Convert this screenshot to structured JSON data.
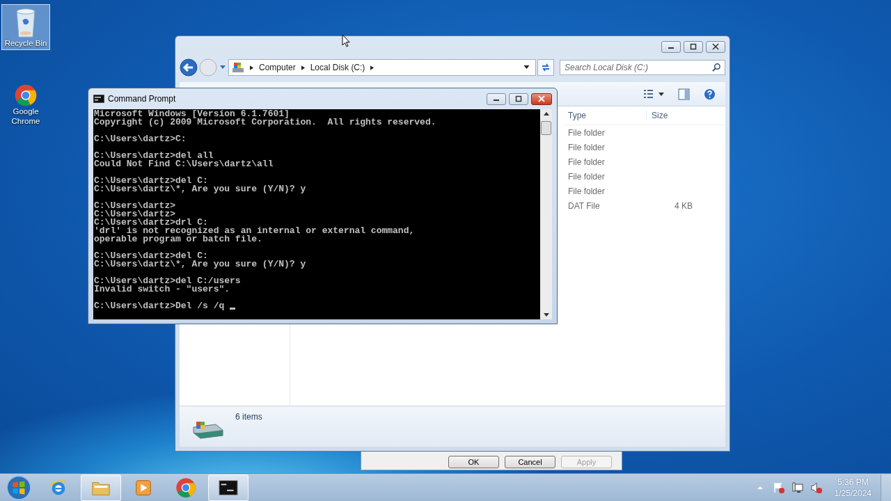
{
  "desktop_icons": [
    {
      "label": "Recycle Bin",
      "kind": "recycle",
      "selected": true
    },
    {
      "label": "Google Chrome",
      "kind": "chrome",
      "selected": false
    }
  ],
  "explorer": {
    "breadcrumbs": [
      "Computer",
      "Local Disk (C:)"
    ],
    "search": {
      "placeholder": "Search Local Disk (C:)"
    },
    "columns": [
      "Type",
      "Size"
    ],
    "rows": [
      {
        "type": "File folder"
      },
      {
        "type": "File folder"
      },
      {
        "type": "File folder"
      },
      {
        "type": "File folder"
      },
      {
        "type": "File folder"
      },
      {
        "type": "DAT File",
        "size": "4 KB"
      }
    ],
    "status": "6 items"
  },
  "dialog_buttons": [
    {
      "label": "OK",
      "disabled": false
    },
    {
      "label": "Cancel",
      "disabled": false
    },
    {
      "label": "Apply",
      "disabled": true
    }
  ],
  "command_prompt": {
    "title": "Command Prompt",
    "blocks": [
      [
        "Microsoft Windows [Version 6.1.7601]",
        "Copyright (c) 2009 Microsoft Corporation.  All rights reserved."
      ],
      [
        "C:\\Users\\dartz>C:"
      ],
      [
        "C:\\Users\\dartz>del all",
        "Could Not Find C:\\Users\\dartz\\all"
      ],
      [
        "C:\\Users\\dartz>del C:",
        "C:\\Users\\dartz\\*, Are you sure (Y/N)? y"
      ],
      [
        "C:\\Users\\dartz>",
        "C:\\Users\\dartz>",
        "C:\\Users\\dartz>drl C:",
        "'drl' is not recognized as an internal or external command,",
        "operable program or batch file."
      ],
      [
        "C:\\Users\\dartz>del C:",
        "C:\\Users\\dartz\\*, Are you sure (Y/N)? y"
      ],
      [
        "C:\\Users\\dartz>del C:/users",
        "Invalid switch - \"users\"."
      ],
      [
        "C:\\Users\\dartz>Del /s /q "
      ]
    ],
    "cursor_visible": true
  },
  "taskbar": {
    "items": [
      {
        "kind": "ie",
        "selected": false
      },
      {
        "kind": "folder",
        "selected": true
      },
      {
        "kind": "media",
        "selected": false
      },
      {
        "kind": "chrome",
        "selected": false
      },
      {
        "kind": "cmd",
        "selected": true
      }
    ],
    "time": "5:36 PM",
    "date": "1/25/2024"
  }
}
